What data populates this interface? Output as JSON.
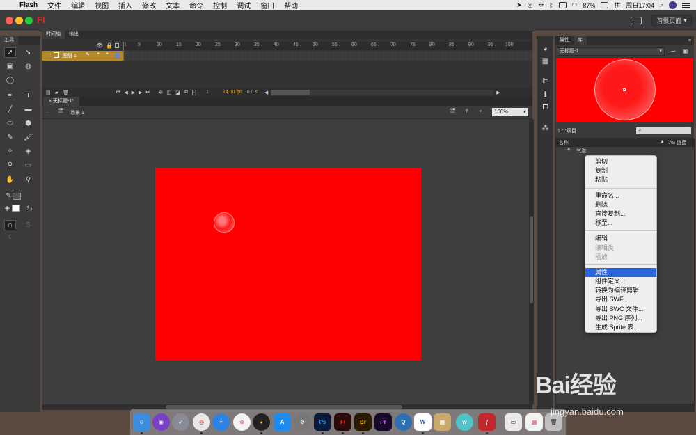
{
  "menubar": {
    "app": "Flash",
    "items": [
      "文件",
      "编辑",
      "视图",
      "插入",
      "修改",
      "文本",
      "命令",
      "控制",
      "调试",
      "窗口",
      "帮助"
    ],
    "battery": "87%",
    "input_method": "拼",
    "clock": "周日17:04"
  },
  "titlebar": {
    "logo": "Fl",
    "workspace": "习惯页面"
  },
  "tools": {
    "panel_title": "工具"
  },
  "timeline": {
    "tabs": [
      "时间轴",
      "输出"
    ],
    "layer_name": "图层 1",
    "ruler_numbers": [
      "1",
      "5",
      "10",
      "15",
      "20",
      "25",
      "30",
      "35",
      "40",
      "45",
      "50",
      "55",
      "60",
      "65",
      "70",
      "75",
      "80",
      "85",
      "90",
      "95",
      "100"
    ],
    "current_frame": "1",
    "fps": "24.00 fps",
    "time": "0.0 s"
  },
  "document": {
    "tab": "无标题-1*",
    "scene": "场景 1",
    "zoom": "100%"
  },
  "library": {
    "tabs": [
      "属性",
      "库"
    ],
    "doc_select": "无标题-1",
    "count": "1 个项目",
    "col_name": "名称",
    "col_linkage": "AS 链接",
    "item_name": "气泡"
  },
  "context_menu": {
    "group1": [
      "剪切",
      "复制",
      "粘贴"
    ],
    "group2": [
      "重命名...",
      "删除",
      "直接复制...",
      "移至..."
    ],
    "group3_enabled": [
      "编辑"
    ],
    "group3_disabled": [
      "编辑类",
      "播放"
    ],
    "group4": [
      "属性...",
      "组件定义...",
      "转换为编译剪辑",
      "导出 SWF...",
      "导出 SWC 文件...",
      "导出 PNG 序列...",
      "生成 Sprite 表..."
    ],
    "highlighted": "属性..."
  },
  "dock": {
    "apps": [
      "Ps",
      "Fl",
      "Br",
      "Pr",
      "W"
    ]
  },
  "watermark": {
    "logo": "Bai经验",
    "url": "jingyan.baidu.com"
  },
  "colors": {
    "stage": "#ff0000",
    "timeline_layer": "#b1882a",
    "highlight": "#2a66d9"
  }
}
